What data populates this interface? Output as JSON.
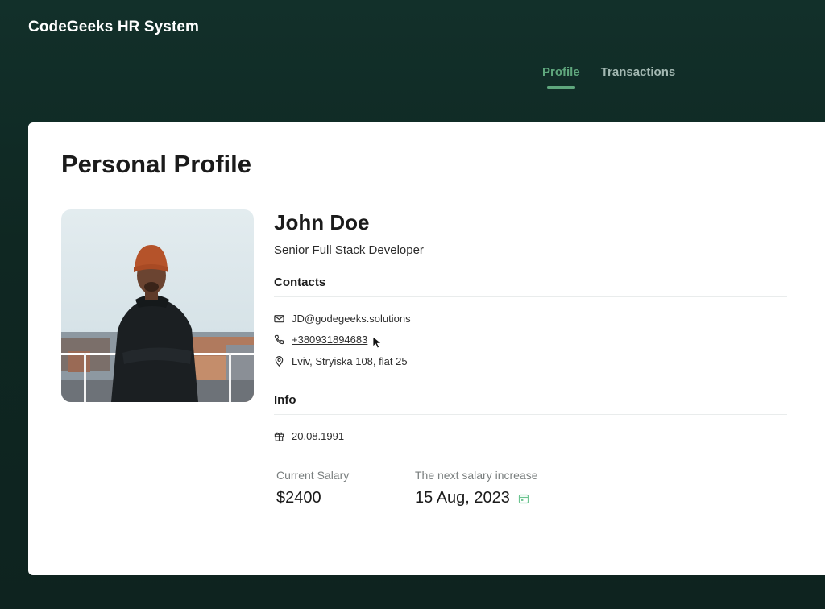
{
  "app": {
    "title": "CodeGeeks HR System"
  },
  "nav": {
    "tabs": [
      {
        "label": "Profile",
        "active": true
      },
      {
        "label": "Transactions",
        "active": false
      }
    ]
  },
  "profile": {
    "page_title": "Personal Profile",
    "name": "John Doe",
    "role": "Senior Full Stack Developer",
    "contacts_title": "Contacts",
    "email": "JD@godegeeks.solutions",
    "phone": "+380931894683",
    "address": "Lviv, Stryiska 108, flat 25",
    "info_title": "Info",
    "birth_date": "20.08.1991",
    "salary_label": "Current Salary",
    "salary_value": "$2400",
    "next_increase_label": "The next salary increase",
    "next_increase_value": "15 Aug, 2023"
  },
  "colors": {
    "accent": "#5fa77d",
    "background": "#0f2621",
    "card": "#ffffff"
  },
  "icons": [
    "mail-icon",
    "phone-icon",
    "location-pin-icon",
    "gift-icon",
    "calendar-icon",
    "mouse-cursor-icon"
  ]
}
